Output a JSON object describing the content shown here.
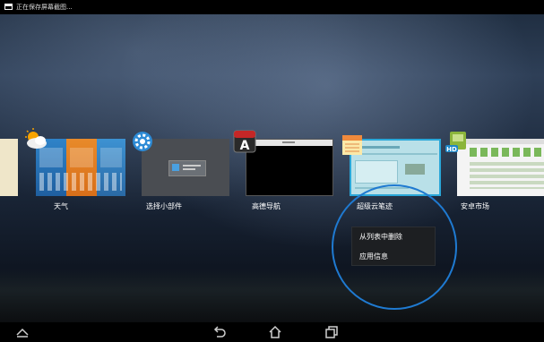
{
  "status_bar": {
    "text": "正在保存屏幕截图..."
  },
  "recent_apps": [
    {
      "label": "天气",
      "icon": "weather-icon"
    },
    {
      "label": "选择小部件",
      "icon": "gear-icon"
    },
    {
      "label": "高德导航",
      "icon": "amap-icon"
    },
    {
      "label": "超级云笔迹",
      "icon": "notes-icon"
    },
    {
      "label": "安卓市场",
      "icon": "market-hd-icon"
    }
  ],
  "context_menu": {
    "items": [
      {
        "label": "从列表中删除"
      },
      {
        "label": "应用信息"
      }
    ]
  },
  "nav_bar": {
    "buttons": [
      "up-arrow-icon",
      "back-icon",
      "home-icon",
      "recent-apps-icon"
    ]
  },
  "colors": {
    "highlight": "#1f7ad1",
    "notes_border": "#2aa7d8"
  }
}
